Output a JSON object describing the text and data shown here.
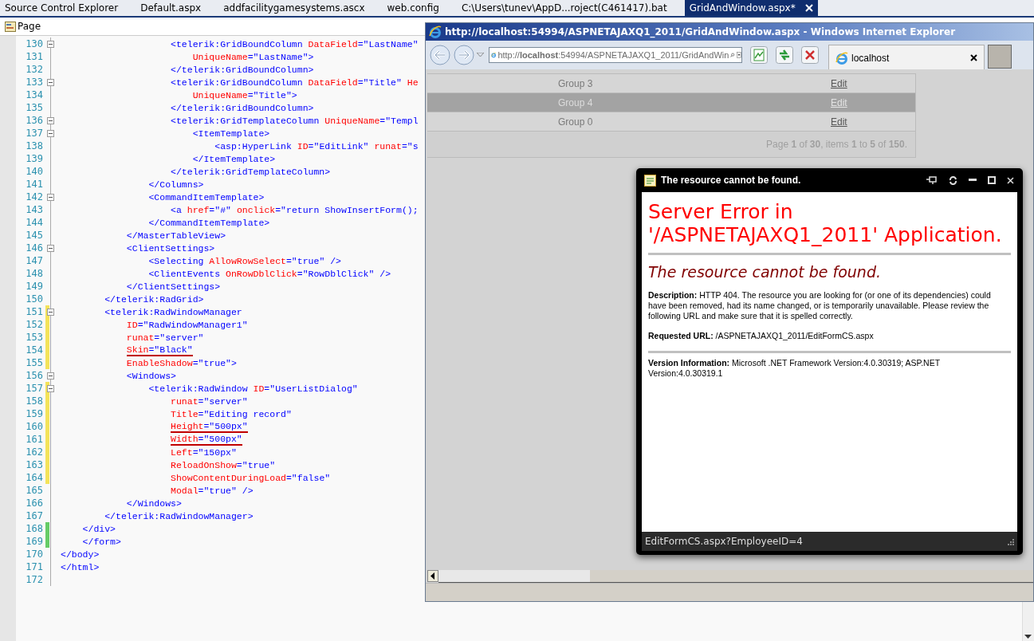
{
  "editor_tabs": [
    {
      "label": "Source Control Explorer",
      "selected": false
    },
    {
      "label": "Default.aspx",
      "selected": false
    },
    {
      "label": "addfacilitygamesystems.ascx",
      "selected": false
    },
    {
      "label": "web.config",
      "selected": false
    },
    {
      "label": "C:\\Users\\tunev\\AppD...roject(C461417).bat",
      "selected": false
    },
    {
      "label": "GridAndWindow.aspx*",
      "selected": true
    }
  ],
  "navigation_bar": {
    "label": "Page"
  },
  "code_lines": [
    {
      "number": "130",
      "fold": true,
      "modified": false,
      "saved": false,
      "underlined": false,
      "tokens": [
        {
          "kind": "markup",
          "text": "                    <telerik:GridBoundColumn "
        },
        {
          "kind": "attr",
          "text": "DataField"
        },
        {
          "kind": "markup",
          "text": "=\"LastName\""
        }
      ]
    },
    {
      "number": "131",
      "fold": false,
      "modified": false,
      "saved": false,
      "underlined": false,
      "tokens": [
        {
          "kind": "attr",
          "text": "                        UniqueName"
        },
        {
          "kind": "markup",
          "text": "=\"LastName\">"
        }
      ]
    },
    {
      "number": "132",
      "fold": false,
      "modified": false,
      "saved": false,
      "underlined": false,
      "tokens": [
        {
          "kind": "markup",
          "text": "                    </telerik:GridBoundColumn>"
        }
      ]
    },
    {
      "number": "133",
      "fold": true,
      "modified": false,
      "saved": false,
      "underlined": false,
      "tokens": [
        {
          "kind": "markup",
          "text": "                    <telerik:GridBoundColumn "
        },
        {
          "kind": "attr",
          "text": "DataField"
        },
        {
          "kind": "markup",
          "text": "=\"Title\" "
        },
        {
          "kind": "attr",
          "text": "He"
        }
      ]
    },
    {
      "number": "134",
      "fold": false,
      "modified": false,
      "saved": false,
      "underlined": false,
      "tokens": [
        {
          "kind": "attr",
          "text": "                        UniqueName"
        },
        {
          "kind": "markup",
          "text": "=\"Title\">"
        }
      ]
    },
    {
      "number": "135",
      "fold": false,
      "modified": false,
      "saved": false,
      "underlined": false,
      "tokens": [
        {
          "kind": "markup",
          "text": "                    </telerik:GridBoundColumn>"
        }
      ]
    },
    {
      "number": "136",
      "fold": true,
      "modified": false,
      "saved": false,
      "underlined": false,
      "tokens": [
        {
          "kind": "markup",
          "text": "                    <telerik:GridTemplateColumn "
        },
        {
          "kind": "attr",
          "text": "UniqueName"
        },
        {
          "kind": "markup",
          "text": "=\"Templ"
        }
      ]
    },
    {
      "number": "137",
      "fold": true,
      "modified": false,
      "saved": false,
      "underlined": false,
      "tokens": [
        {
          "kind": "markup",
          "text": "                        <ItemTemplate>"
        }
      ]
    },
    {
      "number": "138",
      "fold": false,
      "modified": false,
      "saved": false,
      "underlined": false,
      "tokens": [
        {
          "kind": "markup",
          "text": "                            <asp:HyperLink "
        },
        {
          "kind": "attr",
          "text": "ID"
        },
        {
          "kind": "markup",
          "text": "=\"EditLink\" "
        },
        {
          "kind": "attr",
          "text": "runat"
        },
        {
          "kind": "markup",
          "text": "=\"s"
        }
      ]
    },
    {
      "number": "139",
      "fold": false,
      "modified": false,
      "saved": false,
      "underlined": false,
      "tokens": [
        {
          "kind": "markup",
          "text": "                        </ItemTemplate>"
        }
      ]
    },
    {
      "number": "140",
      "fold": false,
      "modified": false,
      "saved": false,
      "underlined": false,
      "tokens": [
        {
          "kind": "markup",
          "text": "                    </telerik:GridTemplateColumn>"
        }
      ]
    },
    {
      "number": "141",
      "fold": false,
      "modified": false,
      "saved": false,
      "underlined": false,
      "tokens": [
        {
          "kind": "markup",
          "text": "                </Columns>"
        }
      ]
    },
    {
      "number": "142",
      "fold": true,
      "modified": false,
      "saved": false,
      "underlined": false,
      "tokens": [
        {
          "kind": "markup",
          "text": "                <CommandItemTemplate>"
        }
      ]
    },
    {
      "number": "143",
      "fold": false,
      "modified": false,
      "saved": false,
      "underlined": false,
      "tokens": [
        {
          "kind": "markup",
          "text": "                    <a "
        },
        {
          "kind": "attr",
          "text": "href"
        },
        {
          "kind": "markup",
          "text": "=\"#\" "
        },
        {
          "kind": "attr",
          "text": "onclick"
        },
        {
          "kind": "markup",
          "text": "=\"return ShowInsertForm();"
        }
      ]
    },
    {
      "number": "144",
      "fold": false,
      "modified": false,
      "saved": false,
      "underlined": false,
      "tokens": [
        {
          "kind": "markup",
          "text": "                </CommandItemTemplate>"
        }
      ]
    },
    {
      "number": "145",
      "fold": false,
      "modified": false,
      "saved": false,
      "underlined": false,
      "tokens": [
        {
          "kind": "markup",
          "text": "            </MasterTableView>"
        }
      ]
    },
    {
      "number": "146",
      "fold": true,
      "modified": false,
      "saved": false,
      "underlined": false,
      "tokens": [
        {
          "kind": "markup",
          "text": "            <ClientSettings>"
        }
      ]
    },
    {
      "number": "147",
      "fold": false,
      "modified": false,
      "saved": false,
      "underlined": false,
      "tokens": [
        {
          "kind": "markup",
          "text": "                <Selecting "
        },
        {
          "kind": "attr",
          "text": "AllowRowSelect"
        },
        {
          "kind": "markup",
          "text": "=\"true\" />"
        }
      ]
    },
    {
      "number": "148",
      "fold": false,
      "modified": false,
      "saved": false,
      "underlined": false,
      "tokens": [
        {
          "kind": "markup",
          "text": "                <ClientEvents "
        },
        {
          "kind": "attr",
          "text": "OnRowDblClick"
        },
        {
          "kind": "markup",
          "text": "=\"RowDblClick\" />"
        }
      ]
    },
    {
      "number": "149",
      "fold": false,
      "modified": false,
      "saved": false,
      "underlined": false,
      "tokens": [
        {
          "kind": "markup",
          "text": "            </ClientSettings>"
        }
      ]
    },
    {
      "number": "150",
      "fold": false,
      "modified": false,
      "saved": false,
      "underlined": false,
      "tokens": [
        {
          "kind": "markup",
          "text": "        </telerik:RadGrid>"
        }
      ]
    },
    {
      "number": "151",
      "fold": true,
      "modified": true,
      "saved": false,
      "underlined": false,
      "tokens": [
        {
          "kind": "markup",
          "text": "        <telerik:RadWindowManager"
        }
      ]
    },
    {
      "number": "152",
      "fold": false,
      "modified": true,
      "saved": false,
      "underlined": false,
      "tokens": [
        {
          "kind": "attr",
          "text": "            ID"
        },
        {
          "kind": "markup",
          "text": "=\"RadWindowManager1\""
        }
      ]
    },
    {
      "number": "153",
      "fold": false,
      "modified": true,
      "saved": false,
      "underlined": false,
      "tokens": [
        {
          "kind": "attr",
          "text": "            runat"
        },
        {
          "kind": "markup",
          "text": "=\"server\""
        }
      ]
    },
    {
      "number": "154",
      "fold": false,
      "modified": true,
      "saved": false,
      "underlined": true,
      "tokens": [
        {
          "kind": "attr",
          "text": "            Skin"
        },
        {
          "kind": "markup",
          "text": "=\"Black\""
        }
      ]
    },
    {
      "number": "155",
      "fold": false,
      "modified": true,
      "saved": false,
      "underlined": false,
      "tokens": [
        {
          "kind": "attr",
          "text": "            EnableShadow"
        },
        {
          "kind": "markup",
          "text": "=\"true\">"
        }
      ]
    },
    {
      "number": "156",
      "fold": true,
      "modified": false,
      "saved": false,
      "underlined": false,
      "tokens": [
        {
          "kind": "markup",
          "text": "            <Windows>"
        }
      ]
    },
    {
      "number": "157",
      "fold": true,
      "modified": true,
      "saved": false,
      "underlined": false,
      "tokens": [
        {
          "kind": "markup",
          "text": "                <telerik:RadWindow "
        },
        {
          "kind": "attr",
          "text": "ID"
        },
        {
          "kind": "markup",
          "text": "=\"UserListDialog\""
        }
      ]
    },
    {
      "number": "158",
      "fold": false,
      "modified": true,
      "saved": false,
      "underlined": false,
      "tokens": [
        {
          "kind": "attr",
          "text": "                    runat"
        },
        {
          "kind": "markup",
          "text": "=\"server\""
        }
      ]
    },
    {
      "number": "159",
      "fold": false,
      "modified": true,
      "saved": false,
      "underlined": false,
      "tokens": [
        {
          "kind": "attr",
          "text": "                    Title"
        },
        {
          "kind": "markup",
          "text": "=\"Editing record\""
        }
      ]
    },
    {
      "number": "160",
      "fold": false,
      "modified": true,
      "saved": false,
      "underlined": true,
      "tokens": [
        {
          "kind": "attr",
          "text": "                    Height"
        },
        {
          "kind": "markup",
          "text": "=\"500px\""
        }
      ]
    },
    {
      "number": "161",
      "fold": false,
      "modified": true,
      "saved": false,
      "underlined": true,
      "tokens": [
        {
          "kind": "attr",
          "text": "                    Width"
        },
        {
          "kind": "markup",
          "text": "=\"500px\""
        }
      ]
    },
    {
      "number": "162",
      "fold": false,
      "modified": true,
      "saved": false,
      "underlined": false,
      "tokens": [
        {
          "kind": "attr",
          "text": "                    Left"
        },
        {
          "kind": "markup",
          "text": "=\"150px\""
        }
      ]
    },
    {
      "number": "163",
      "fold": false,
      "modified": true,
      "saved": false,
      "underlined": false,
      "tokens": [
        {
          "kind": "attr",
          "text": "                    ReloadOnShow"
        },
        {
          "kind": "markup",
          "text": "=\"true\""
        }
      ]
    },
    {
      "number": "164",
      "fold": false,
      "modified": true,
      "saved": false,
      "underlined": false,
      "tokens": [
        {
          "kind": "attr",
          "text": "                    ShowContentDuringLoad"
        },
        {
          "kind": "markup",
          "text": "=\"false\""
        }
      ]
    },
    {
      "number": "165",
      "fold": false,
      "modified": false,
      "saved": false,
      "underlined": false,
      "tokens": [
        {
          "kind": "attr",
          "text": "                    Modal"
        },
        {
          "kind": "markup",
          "text": "=\"true\" />"
        }
      ]
    },
    {
      "number": "166",
      "fold": false,
      "modified": false,
      "saved": false,
      "underlined": false,
      "tokens": [
        {
          "kind": "markup",
          "text": "            </Windows>"
        }
      ]
    },
    {
      "number": "167",
      "fold": false,
      "modified": false,
      "saved": false,
      "underlined": false,
      "tokens": [
        {
          "kind": "markup",
          "text": "        </telerik:RadWindowManager>"
        }
      ]
    },
    {
      "number": "168",
      "fold": false,
      "modified": false,
      "saved": true,
      "underlined": false,
      "tokens": [
        {
          "kind": "markup",
          "text": "    </div>"
        }
      ]
    },
    {
      "number": "169",
      "fold": false,
      "modified": false,
      "saved": true,
      "underlined": false,
      "tokens": [
        {
          "kind": "markup",
          "text": "    </form>"
        }
      ]
    },
    {
      "number": "170",
      "fold": false,
      "modified": false,
      "saved": false,
      "underlined": false,
      "tokens": [
        {
          "kind": "markup",
          "text": "</body>"
        }
      ]
    },
    {
      "number": "171",
      "fold": false,
      "modified": false,
      "saved": false,
      "underlined": false,
      "tokens": [
        {
          "kind": "markup",
          "text": "</html>"
        }
      ]
    },
    {
      "number": "172",
      "fold": false,
      "modified": false,
      "saved": false,
      "underlined": false
    }
  ],
  "browser": {
    "title": "http://localhost:54994/ASPNETAJAXQ1_2011/GridAndWindow.aspx - Windows Internet Explorer",
    "address": "http://**localhost**:54994/ASPNETAJAXQ1_2011/GridAndWin",
    "tab_label": "localhost",
    "grid_rows": [
      {
        "name": "Group 3",
        "link": "Edit",
        "selected": false
      },
      {
        "name": "Group 4",
        "link": "Edit",
        "selected": true
      },
      {
        "name": "Group 0",
        "link": "Edit",
        "selected": false
      }
    ],
    "pager": "Page **1** of **30**, items **1** to **5** of **150**.",
    "dialog": {
      "title": "The resource cannot be found.",
      "heading": "Server Error in '/ASPNETAJAXQ1_2011' Application.",
      "subheading": "The resource cannot be found.",
      "description": "**Description:** HTTP 404. The resource you are looking for (or one of its dependencies) could have been removed, had its name changed, or is temporarily unavailable.  Please review the following URL and make sure that it is spelled correctly.",
      "requested_url": "**Requested URL:** /ASPNETAJAXQ1_2011/EditFormCS.aspx",
      "version": "**Version Information:** Microsoft .NET Framework Version:4.0.30319; ASP.NET Version:4.0.30319.1",
      "status": "EditFormCS.aspx?EmployeeID=4"
    }
  }
}
